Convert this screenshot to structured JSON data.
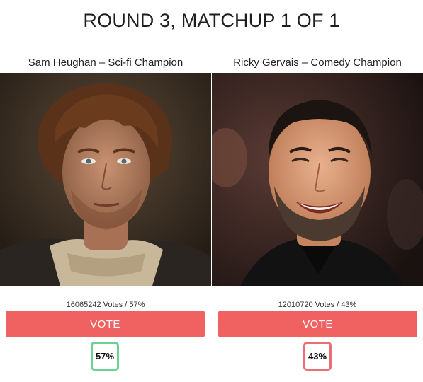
{
  "page": {
    "title": "ROUND 3, MATCHUP 1 OF 1"
  },
  "contestants": [
    {
      "name": "Sam Heughan – Sci-fi Champion",
      "votes_text": "16065242 Votes / 57%",
      "vote_label": "VOTE",
      "percent_label": "57%",
      "percent": 57,
      "badge_color": "#6dd196"
    },
    {
      "name": "Ricky Gervais – Comedy Champion",
      "votes_text": "12010720 Votes / 43%",
      "vote_label": "VOTE",
      "percent_label": "43%",
      "percent": 43,
      "badge_color": "#ea6f74"
    }
  ],
  "colors": {
    "vote_button": "#f06262"
  }
}
